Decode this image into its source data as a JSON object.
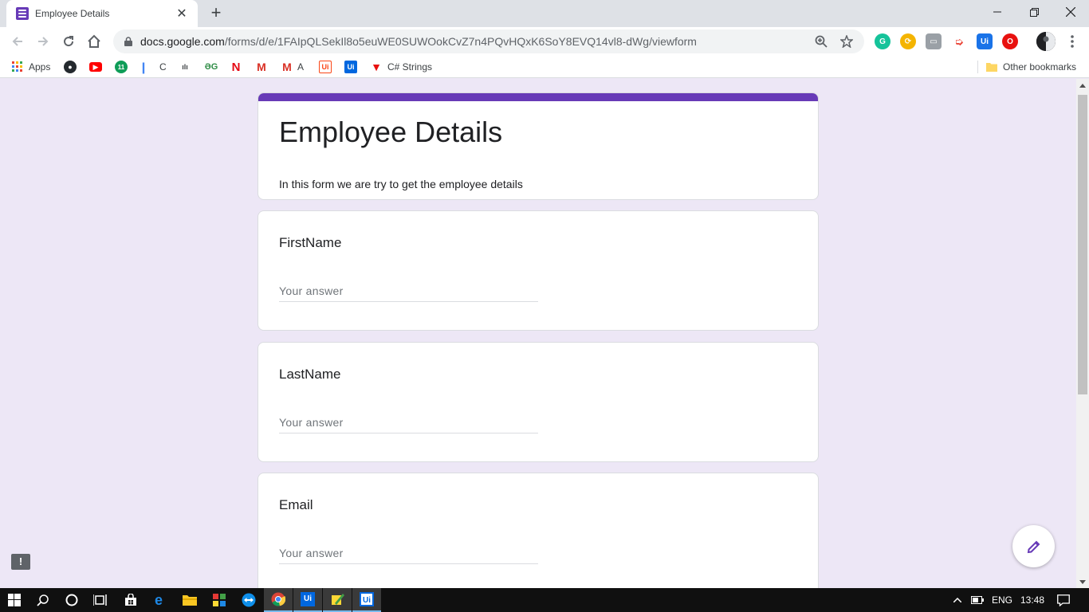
{
  "browser": {
    "tab_title": "Employee Details",
    "tab_close": "✕",
    "new_tab": "+",
    "url_host": "docs.google.com",
    "url_path": "/forms/d/e/1FAIpQLSekIl8o5euWE0SUWOokCvZ7n4PQvHQxK6SoY8EVQ14vl8-dWg/viewform",
    "window_controls": {
      "minimize": "—",
      "restore": "❐",
      "close": "✕"
    },
    "extensions": [
      {
        "name": "grammarly-icon",
        "label": "G",
        "color": "#15c39a"
      },
      {
        "name": "sync-icon",
        "label": "⟳",
        "color": "#f4b400"
      },
      {
        "name": "screen-capture-icon",
        "label": "▭",
        "color": "#9aa0a6"
      },
      {
        "name": "cast-icon",
        "label": "➭",
        "color": "#ea4335"
      },
      {
        "name": "uipath-icon",
        "label": "Ui",
        "color": "#1a73e8"
      },
      {
        "name": "opera-icon",
        "label": "O",
        "color": "#e8110f"
      }
    ]
  },
  "bookmarks": {
    "apps_label": "Apps",
    "items": [
      {
        "name": "bookmark-github",
        "label": "",
        "icon": "●",
        "color": "#24292e"
      },
      {
        "name": "bookmark-youtube",
        "label": "",
        "icon": "▶",
        "color": "#ff0000"
      },
      {
        "name": "bookmark-11",
        "label": "",
        "icon": "11",
        "color": "#0f9d58"
      },
      {
        "name": "bookmark-feather",
        "label": "",
        "icon": "❙",
        "color": "#4285f4"
      },
      {
        "name": "bookmark-c",
        "label": "C",
        "icon": "",
        "color": "#3c4043"
      },
      {
        "name": "bookmark-cisco",
        "label": "",
        "icon": "ılı",
        "color": "#3c4043"
      },
      {
        "name": "bookmark-geeksforgeeks",
        "label": "",
        "icon": "ƏG",
        "color": "#2f8d46"
      },
      {
        "name": "bookmark-netflix",
        "label": "",
        "icon": "N",
        "color": "#e50914"
      },
      {
        "name": "bookmark-gmail",
        "label": "",
        "icon": "M",
        "color": "#d93025"
      },
      {
        "name": "bookmark-gmail-a",
        "label": "A",
        "icon": "M",
        "color": "#d93025"
      },
      {
        "name": "bookmark-uipath-orange",
        "label": "",
        "icon": "Ui",
        "color": "#fa4616"
      },
      {
        "name": "bookmark-uipath-blue",
        "label": "",
        "icon": "Ui",
        "color": "#0067df"
      },
      {
        "name": "bookmark-csharp-strings",
        "label": "C# Strings",
        "icon": "▼",
        "color": "#e8110f"
      }
    ],
    "other_label": "Other bookmarks"
  },
  "form": {
    "title": "Employee Details",
    "description": "In this form we are try to get the employee details",
    "accent_color": "#673ab7",
    "background_color": "#ede7f6",
    "questions": [
      {
        "label": "FirstName",
        "placeholder": "Your answer"
      },
      {
        "label": "LastName",
        "placeholder": "Your answer"
      },
      {
        "label": "Email",
        "placeholder": "Your answer"
      }
    ]
  },
  "feedback_label": "!",
  "taskbar": {
    "language": "ENG",
    "time": "13:48"
  }
}
